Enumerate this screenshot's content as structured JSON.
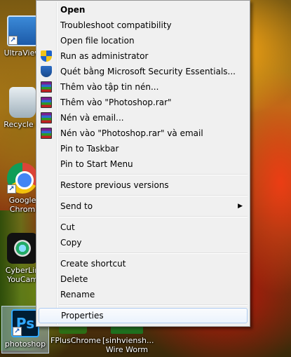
{
  "desktop": {
    "icons": [
      {
        "label": "UltraView",
        "icon": "ultraviewer-icon"
      },
      {
        "label": "Recycle B",
        "icon": "recycle-bin-icon"
      },
      {
        "label": "Google Chrom",
        "icon": "chrome-icon"
      },
      {
        "label": "CyberLin YouCam",
        "icon": "cyberlink-youcam-icon"
      },
      {
        "label": "photoshop",
        "icon": "photoshop-icon"
      },
      {
        "label": "FPlusChrome",
        "icon": "fpluschrome-icon"
      },
      {
        "label": "[sinhviensh... Wire Worm",
        "icon": "sinhvien-icon"
      }
    ],
    "photoshop_glyph": "Ps",
    "shortcut_glyph": "↗"
  },
  "context_menu": {
    "open": "Open",
    "troubleshoot": "Troubleshoot compatibility",
    "open_location": "Open file location",
    "run_admin": "Run as administrator",
    "scan_mse": "Quét bằng Microsoft Security Essentials...",
    "add_archive": "Thêm vào tập tin nén...",
    "add_rar": "Thêm vào \"Photoshop.rar\"",
    "compress_email": "Nén và email...",
    "compress_rar_email": "Nén vào \"Photoshop.rar\" và email",
    "pin_taskbar": "Pin to Taskbar",
    "pin_start": "Pin to Start Menu",
    "restore_versions": "Restore previous versions",
    "send_to": "Send to",
    "send_to_arrow": "▶",
    "cut": "Cut",
    "copy": "Copy",
    "create_shortcut": "Create shortcut",
    "delete": "Delete",
    "rename": "Rename",
    "properties": "Properties",
    "highlighted_item": "Properties"
  }
}
